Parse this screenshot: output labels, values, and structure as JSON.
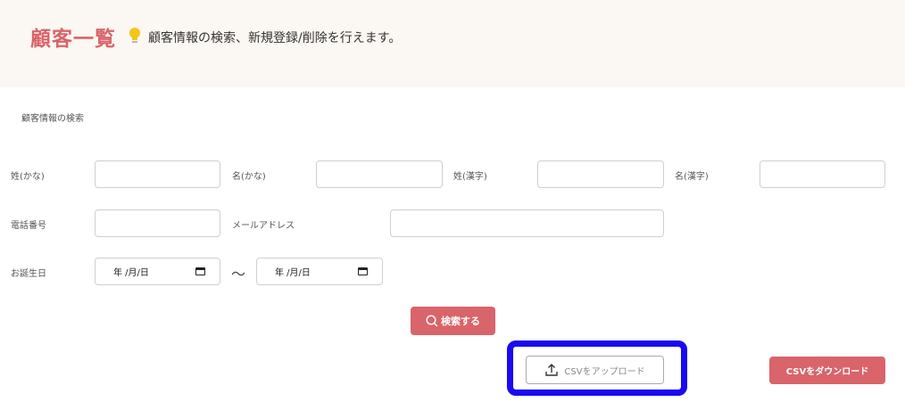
{
  "header": {
    "title": "顧客一覧",
    "description": "顧客情報の検索、新規登録/削除を行えます。",
    "accent_color": "#d9646a",
    "icon": "lightbulb-icon"
  },
  "search_form": {
    "section_title": "顧客情報の検索",
    "fields": {
      "last_kana": {
        "label": "姓(かな)",
        "value": ""
      },
      "first_kana": {
        "label": "名(かな)",
        "value": ""
      },
      "last_kanji": {
        "label": "姓(漢字)",
        "value": ""
      },
      "first_kanji": {
        "label": "名(漢字)",
        "value": ""
      },
      "phone": {
        "label": "電話番号",
        "value": ""
      },
      "email": {
        "label": "メールアドレス",
        "value": ""
      },
      "birthday": {
        "label": "お誕生日",
        "from_value": "年 /月/日",
        "separator": "〜",
        "to_value": "年 /月/日"
      }
    },
    "search_button": "検索する"
  },
  "actions": {
    "upload_button": "CSVをアップロード",
    "download_button": "CSVをダウンロード",
    "highlight_color": "#1a0af2"
  }
}
